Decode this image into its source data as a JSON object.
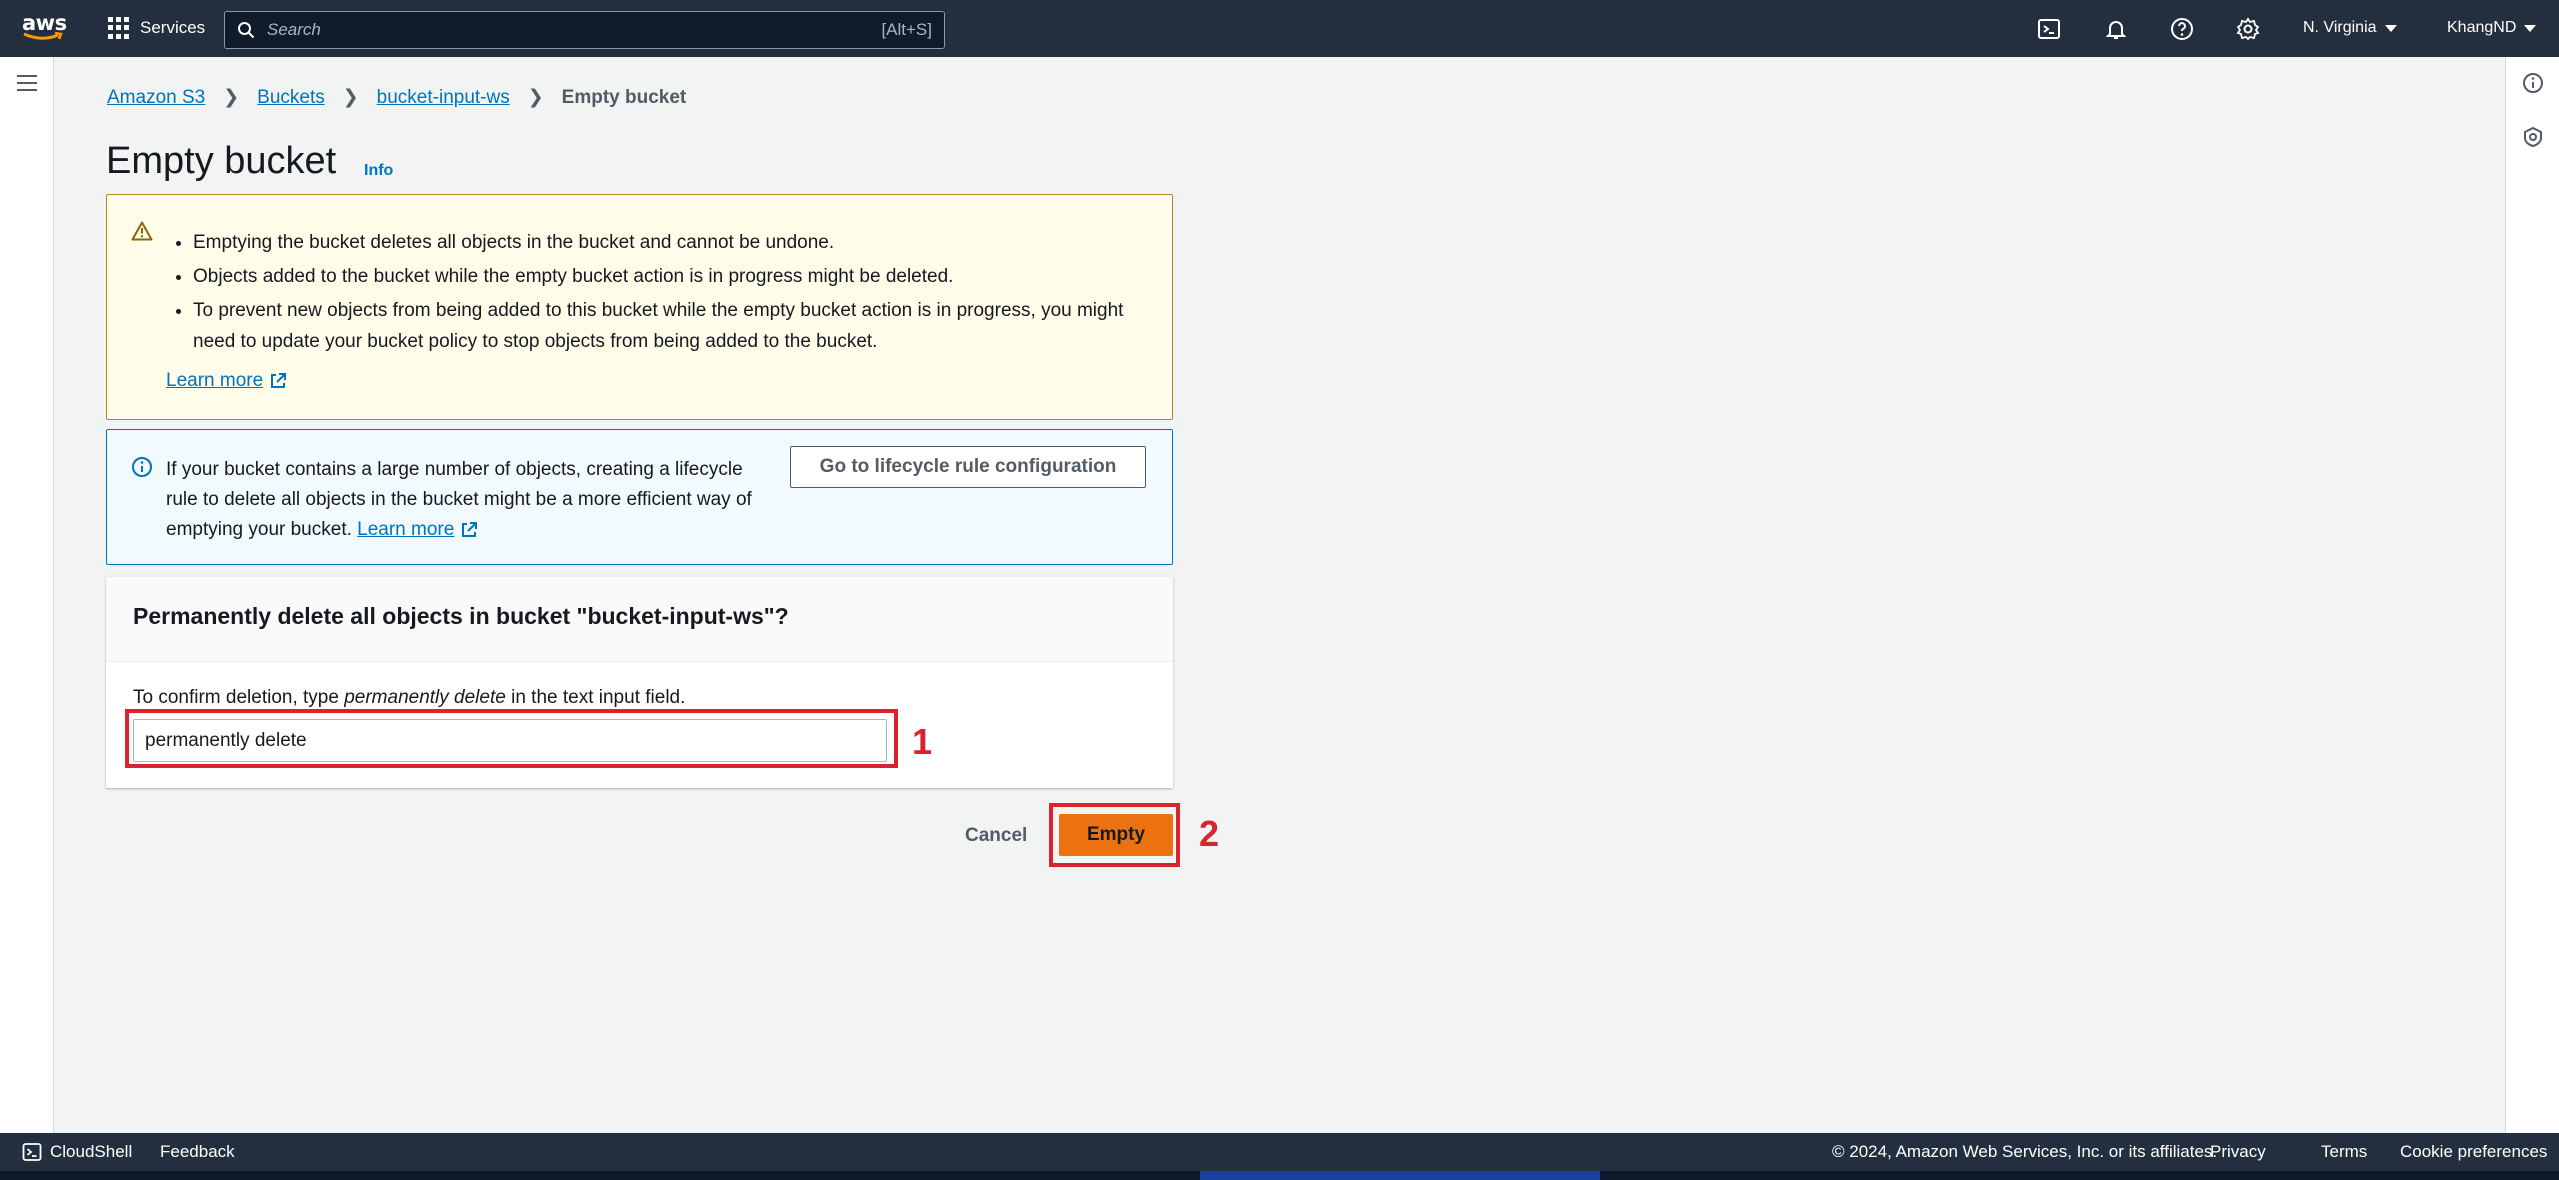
{
  "nav": {
    "logo_text": "aws",
    "services_label": "Services",
    "search_placeholder": "Search",
    "search_shortcut": "[Alt+S]",
    "region_label": "N. Virginia",
    "user_label": "KhangND"
  },
  "breadcrumb": {
    "items": [
      "Amazon S3",
      "Buckets",
      "bucket-input-ws"
    ],
    "current": "Empty bucket"
  },
  "page": {
    "title": "Empty bucket",
    "info_label": "Info"
  },
  "warning": {
    "items": [
      "Emptying the bucket deletes all objects in the bucket and cannot be undone.",
      "Objects added to the bucket while the empty bucket action is in progress might be deleted.",
      "To prevent new objects from being added to this bucket while the empty bucket action is in progress, you might need to update your bucket policy to stop objects from being added to the bucket."
    ],
    "learn_more": "Learn more"
  },
  "info": {
    "message": "If your bucket contains a large number of objects, creating a lifecycle rule to delete all objects in the bucket might be a more efficient way of emptying your bucket.",
    "learn_more": "Learn more",
    "button_label": "Go to lifecycle rule configuration"
  },
  "confirm": {
    "title": "Permanently delete all objects in bucket \"bucket-input-ws\"?",
    "instruction_prefix": "To confirm deletion, type ",
    "instruction_phrase": "permanently delete",
    "instruction_suffix": " in the text input field.",
    "input_value": "permanently delete"
  },
  "actions": {
    "cancel_label": "Cancel",
    "empty_label": "Empty"
  },
  "annotations": {
    "step1": "1",
    "step2": "2"
  },
  "footer": {
    "cloudshell": "CloudShell",
    "feedback": "Feedback",
    "copyright": "© 2024, Amazon Web Services, Inc. or its affiliates.",
    "privacy": "Privacy",
    "terms": "Terms",
    "cookie": "Cookie preferences"
  },
  "colors": {
    "nav_bg": "#232f3e",
    "link": "#0073bb",
    "primary_button": "#ec7211",
    "warning_bg": "#fffce9",
    "info_bg": "#f1faff",
    "highlight": "#d9232e"
  }
}
